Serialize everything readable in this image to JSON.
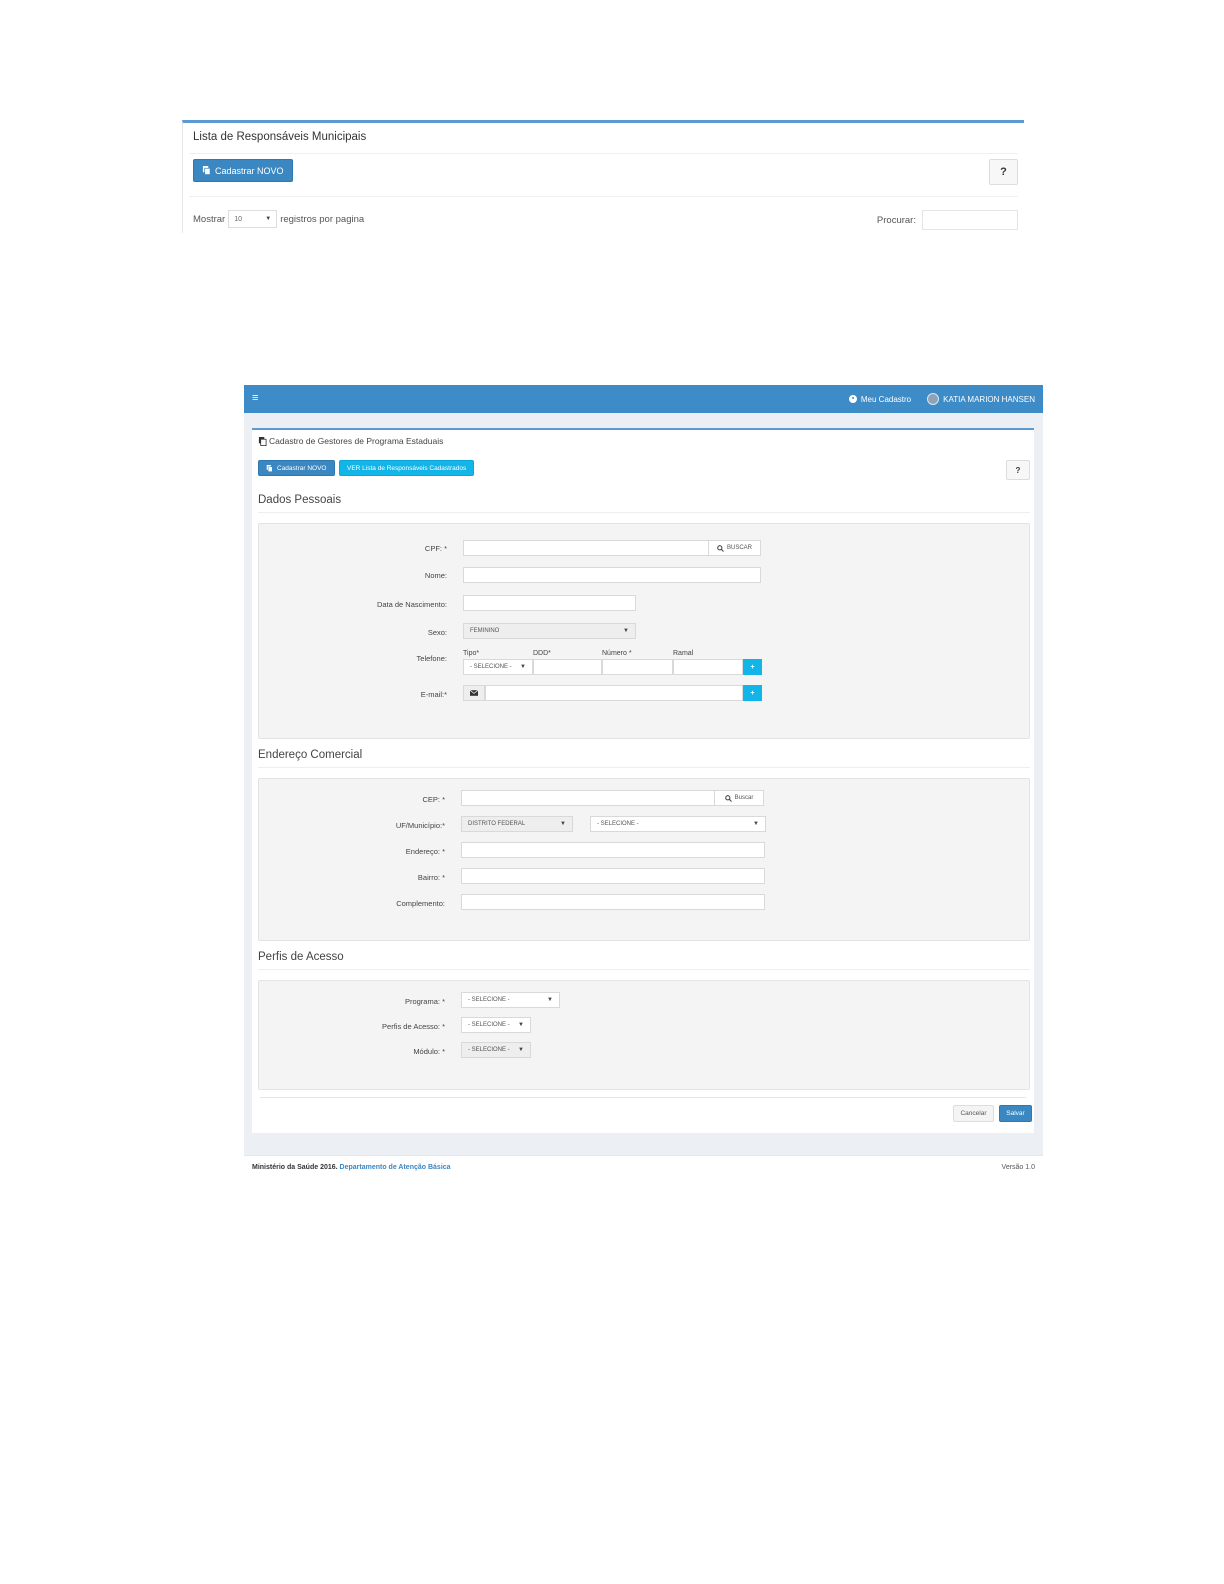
{
  "list_panel": {
    "title": "Lista de Responsáveis Municipais",
    "new_button": "Cadastrar NOVO",
    "help_button": "?",
    "show_prefix": "Mostrar",
    "show_value": "10",
    "show_suffix": "registros por pagina",
    "search_label": "Procurar:"
  },
  "navbar": {
    "menu_icon": "≡",
    "my_profile": "Meu Cadastro",
    "user_name": "KATIA MARION HANSEN"
  },
  "form": {
    "title": "Cadastro de Gestores de Programa Estaduais",
    "new_button": "Cadastrar NOVO",
    "list_button": "VER Lista de Responsáveis Cadastrados",
    "help_button": "?",
    "personal": {
      "section_title": "Dados Pessoais",
      "cpf_label": "CPF: *",
      "cpf_search": "BUSCAR",
      "name_label": "Nome:",
      "birth_label": "Data de Nascimento:",
      "sex_label": "Sexo:",
      "sex_value": "FEMININO",
      "phone_label": "Telefone:",
      "phone_type_label": "Tipo*",
      "phone_type_value": "- SELECIONE -",
      "phone_ddd_label": "DDD*",
      "phone_number_label": "Número *",
      "phone_ext_label": "Ramal",
      "phone_add": "+",
      "email_label": "E-mail:*",
      "email_add": "+"
    },
    "address": {
      "section_title": "Endereço Comercial",
      "cep_label": "CEP: *",
      "cep_search": "Buscar",
      "uf_label": "UF/Município:*",
      "uf_value": "DISTRITO FEDERAL",
      "city_value": "- SELECIONE -",
      "street_label": "Endereço: *",
      "district_label": "Bairro: *",
      "complement_label": "Complemento:"
    },
    "access": {
      "section_title": "Perfis de Acesso",
      "program_label": "Programa: *",
      "program_value": "- SELECIONE -",
      "profile_label": "Perfis de Acesso: *",
      "profile_value": "- SELECIONE -",
      "module_label": "Módulo: *",
      "module_value": "- SELECIONE -"
    },
    "cancel_button": "Cancelar",
    "save_button": "Salvar"
  },
  "footer": {
    "ministry": "Ministério da Saúde 2016.",
    "department": "Departamento de Atenção Básica",
    "version": "Versão 1.0"
  },
  "colors": {
    "navbar": "#3d8bc7",
    "primary_button": "#3a87c2",
    "info_button": "#12b5e8"
  }
}
